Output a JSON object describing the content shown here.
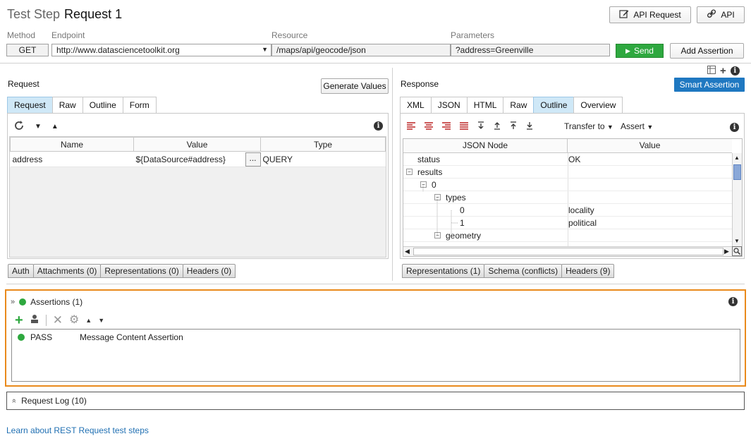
{
  "header": {
    "prefix": "Test Step",
    "name": "Request 1",
    "api_request_button": "API Request",
    "api_button": "API"
  },
  "fields": {
    "method_label": "Method",
    "endpoint_label": "Endpoint",
    "resource_label": "Resource",
    "parameters_label": "Parameters",
    "method_value": "GET",
    "endpoint_value": "http://www.datasciencetoolkit.org",
    "resource_value": "/maps/api/geocode/json",
    "parameters_value": "?address=Greenville",
    "send_button": "Send",
    "add_assertion_button": "Add Assertion"
  },
  "request": {
    "title": "Request",
    "generate_values_button": "Generate Values",
    "tabs": [
      "Request",
      "Raw",
      "Outline",
      "Form"
    ],
    "active_tab": "Request",
    "columns": [
      "Name",
      "Value",
      "Type"
    ],
    "rows": [
      {
        "name": "address",
        "value": "${DataSource#address}",
        "type": "QUERY"
      }
    ],
    "ellipsis": "...",
    "bottom_tabs": [
      "Auth",
      "Attachments (0)",
      "Representations (0)",
      "Headers (0)"
    ]
  },
  "response": {
    "title": "Response",
    "smart_assertion_button": "Smart Assertion",
    "tabs": [
      "XML",
      "JSON",
      "HTML",
      "Raw",
      "Outline",
      "Overview"
    ],
    "active_tab": "Outline",
    "transfer_to": "Transfer to",
    "assert": "Assert",
    "columns": [
      "JSON Node",
      "Value"
    ],
    "tree": [
      {
        "node": "status",
        "value": "OK"
      },
      {
        "node": "results",
        "value": ""
      },
      {
        "node": "0",
        "value": ""
      },
      {
        "node": "types",
        "value": ""
      },
      {
        "node": "0",
        "value": "locality"
      },
      {
        "node": "1",
        "value": "political"
      },
      {
        "node": "geometry",
        "value": ""
      }
    ],
    "bottom_tabs": [
      "Representations (1)",
      "Schema (conflicts)",
      "Headers (9)"
    ]
  },
  "assertions": {
    "title": "Assertions (1)",
    "status_color": "#2ea83f",
    "items": [
      {
        "status": "PASS",
        "name": "Message Content Assertion"
      }
    ]
  },
  "request_log": {
    "title": "Request Log (10)"
  },
  "footer": {
    "link": "Learn about REST Request test steps"
  },
  "colors": {
    "accent": "#1f78c1",
    "send": "#2ea83f",
    "highlight_border": "#e98a1c",
    "active_tab": "#cfe8f7"
  }
}
